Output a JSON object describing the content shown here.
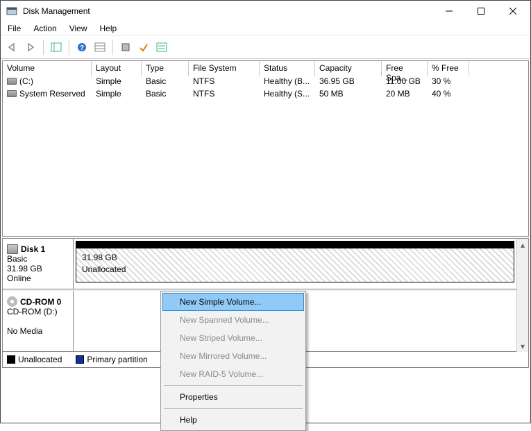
{
  "window": {
    "title": "Disk Management"
  },
  "menu": [
    "File",
    "Action",
    "View",
    "Help"
  ],
  "table": {
    "headers": [
      "Volume",
      "Layout",
      "Type",
      "File System",
      "Status",
      "Capacity",
      "Free Spa...",
      "% Free"
    ],
    "rows": [
      {
        "volume": "(C:)",
        "layout": "Simple",
        "type": "Basic",
        "fs": "NTFS",
        "status": "Healthy (B...",
        "cap": "36.95 GB",
        "free": "11.00 GB",
        "pct": "30 %"
      },
      {
        "volume": "System Reserved",
        "layout": "Simple",
        "type": "Basic",
        "fs": "NTFS",
        "status": "Healthy (S...",
        "cap": "50 MB",
        "free": "20 MB",
        "pct": "40 %"
      }
    ]
  },
  "disks": {
    "d0": {
      "name": "Disk 1",
      "type": "Basic",
      "size": "31.98 GB",
      "status": "Online",
      "part": {
        "line1": "31.98 GB",
        "line2": "Unallocated"
      }
    },
    "d1": {
      "name": "CD-ROM 0",
      "type": "CD-ROM (D:)",
      "size": "",
      "status": "No Media"
    }
  },
  "legend": {
    "a": "Unallocated",
    "b": "Primary partition"
  },
  "ctx": {
    "items": [
      {
        "label": "New Simple Volume...",
        "enabled": true,
        "selected": true
      },
      {
        "label": "New Spanned Volume...",
        "enabled": false,
        "selected": false
      },
      {
        "label": "New Striped Volume...",
        "enabled": false,
        "selected": false
      },
      {
        "label": "New Mirrored Volume...",
        "enabled": false,
        "selected": false
      },
      {
        "label": "New RAID-5 Volume...",
        "enabled": false,
        "selected": false
      }
    ],
    "props": "Properties",
    "help": "Help"
  }
}
